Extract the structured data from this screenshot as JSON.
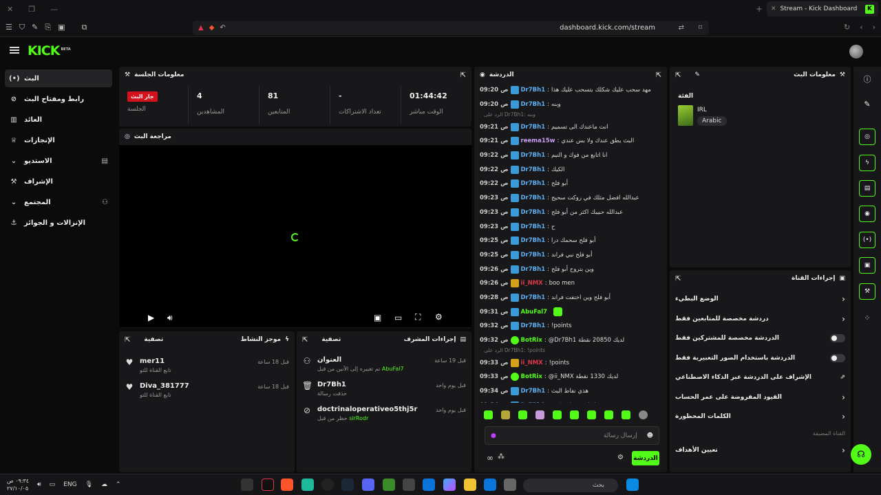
{
  "browser": {
    "tab_title": "Stream - Kick Dashboard",
    "url": "dashboard.kick.com/stream"
  },
  "sidebar": {
    "items": [
      {
        "label": "البث",
        "icon": "broadcast-icon"
      },
      {
        "label": "رابط ومفتاح البث",
        "icon": "link-icon"
      },
      {
        "label": "العائد",
        "icon": "revenue-icon"
      },
      {
        "label": "الإنجازات",
        "icon": "trophy-icon"
      },
      {
        "label": "الاستديو",
        "icon": "studio-icon"
      },
      {
        "label": "الإشراف",
        "icon": "wrench-icon"
      },
      {
        "label": "المجتمع",
        "icon": "community-icon"
      },
      {
        "label": "الإنزالات و الجوائز",
        "icon": "drops-icon"
      }
    ]
  },
  "session": {
    "title": "معلومات الجلسة",
    "live_badge": "جار البث",
    "session_label": "الجلسة",
    "viewers": "4",
    "viewers_label": "المشاهدين",
    "followers": "81",
    "followers_label": "المتابعين",
    "subs": "-",
    "subs_label": "تعداد الاشتراكات",
    "uptime": "01:44:42",
    "uptime_label": "الوقت مباشر"
  },
  "preview": {
    "title": "مراجعة البث"
  },
  "activity": {
    "title": "موجز النشاط",
    "filter": "تصفية",
    "items": [
      {
        "name": "mer11",
        "desc": "تابع القناة للتو",
        "when": "قبل 18 ساعة"
      },
      {
        "name": "Diva_381777",
        "desc": "تابع القناة للتو",
        "when": "قبل 18 ساعة"
      }
    ]
  },
  "mod_actions": {
    "title": "إجراءات المشرف",
    "filter": "تصفية",
    "items": [
      {
        "name": "العنوان",
        "desc_pre": "تم تغييره إلى الآنين من قبل ",
        "desc_user": "AbuFal7",
        "when": "قبل 19 ساعة"
      },
      {
        "name": "Dr7Bh1",
        "desc_pre": "حذفت رسالة",
        "desc_user": "",
        "when": "قبل يوم واحد"
      },
      {
        "name": "doctrinaloperativeo5thj5r",
        "desc_pre": "حظر من قبل ",
        "desc_user": "sirRodr",
        "when": "قبل يوم واحد"
      }
    ]
  },
  "chat": {
    "title": "الدردشة",
    "messages": [
      {
        "time": "09:20",
        "suffix": "ص",
        "user": "Dr7Bh1",
        "color": "#5ab0f0",
        "text": "مهد سحب عليك شكلك بتسحب عليك هذا"
      },
      {
        "time": "09:20",
        "suffix": "ص",
        "user": "Dr7Bh1",
        "color": "#5ab0f0",
        "text": "وبنه"
      },
      {
        "time": "09:21",
        "suffix": "ص",
        "user": "Dr7Bh1",
        "color": "#5ab0f0",
        "text": "انت ماعندك الى تسميم",
        "reply": "الرد على Dr7Bh1: وبنه"
      },
      {
        "time": "09:21",
        "suffix": "ص",
        "user": "reema15w",
        "color": "#c89df5",
        "text": "البث يطق عندك ولا بس عندي"
      },
      {
        "time": "09:22",
        "suffix": "ص",
        "user": "Dr7Bh1",
        "color": "#5ab0f0",
        "text": "انا اتابع من فوك و النيم"
      },
      {
        "time": "09:22",
        "suffix": "ص",
        "user": "Dr7Bh1",
        "color": "#5ab0f0",
        "text": "الكيك"
      },
      {
        "time": "09:22",
        "suffix": "ص",
        "user": "Dr7Bh1",
        "color": "#5ab0f0",
        "text": "أبو فلح"
      },
      {
        "time": "09:23",
        "suffix": "ص",
        "user": "Dr7Bh1",
        "color": "#5ab0f0",
        "text": "عبدالله افضل مثلك في روكت سحيج"
      },
      {
        "time": "09:23",
        "suffix": "ص",
        "user": "Dr7Bh1",
        "color": "#5ab0f0",
        "text": "عبدالله حبيبك اكثر من أبو فلح"
      },
      {
        "time": "09:23",
        "suffix": "ص",
        "user": "Dr7Bh1",
        "color": "#5ab0f0",
        "text": "ح"
      },
      {
        "time": "09:25",
        "suffix": "ص",
        "user": "Dr7Bh1",
        "color": "#5ab0f0",
        "text": "أبو فلح سحمك درا"
      },
      {
        "time": "09:25",
        "suffix": "ص",
        "user": "Dr7Bh1",
        "color": "#5ab0f0",
        "text": "أبو فلح نبي فراند"
      },
      {
        "time": "09:26",
        "suffix": "ص",
        "user": "Dr7Bh1",
        "color": "#5ab0f0",
        "text": "وين بتروح أبو فلح"
      },
      {
        "time": "09:26",
        "suffix": "ص",
        "user": "ii_NMX",
        "color": "#e0364b",
        "text": "boo men"
      },
      {
        "time": "09:28",
        "suffix": "ص",
        "user": "Dr7Bh1",
        "color": "#5ab0f0",
        "text": "أبو فلح وين اختفت فراند"
      },
      {
        "time": "09:31",
        "suffix": "ص",
        "user": "AbuFal7",
        "color": "#53fc18",
        "text": ""
      },
      {
        "time": "09:32",
        "suffix": "ص",
        "user": "Dr7Bh1",
        "color": "#5ab0f0",
        "text": "!points"
      },
      {
        "time": "09:32",
        "suffix": "ص",
        "user": "BotRix",
        "color": "#53fc18",
        "text": "@Dr7Bh1 لديك 20850 نقطة"
      },
      {
        "time": "09:33",
        "suffix": "ص",
        "user": "ii_NMX",
        "color": "#e0364b",
        "text": "!points",
        "reply": "الرد على Dr7Bh1: !points"
      },
      {
        "time": "09:33",
        "suffix": "ص",
        "user": "BotRix",
        "color": "#53fc18",
        "text": "@ii_NMX لديك 1330 نقطة"
      },
      {
        "time": "09:34",
        "suffix": "ص",
        "user": "Dr7Bh1",
        "color": "#5ab0f0",
        "text": "هذي نفاط البث"
      },
      {
        "time": "09:34",
        "suffix": "ص",
        "user": "Dr7Bh1",
        "color": "#5ab0f0",
        "text": "اذ انت متواجد كثير"
      }
    ],
    "input_placeholder": "إرسال رسالة",
    "send_label": "الدردشة"
  },
  "stream_info": {
    "title": "معلومات البث",
    "category_label": "الفئة",
    "category_name": "IRL",
    "language": "Arabic"
  },
  "channel_actions": {
    "title": "إجراءات القناة",
    "items": [
      {
        "label": "الوضع البطيء",
        "kind": "arrow"
      },
      {
        "label": "دردشة مخصصة للمتابعين فقط",
        "kind": "arrow"
      },
      {
        "label": "الدردشة مخصصة للمشتركين فقط",
        "kind": "toggle"
      },
      {
        "label": "الدردشة باستخدام الصور التعبيرية فقط",
        "kind": "toggle"
      },
      {
        "label": "الإشراف على الدردشة عبر الذكاء الاصطناعي",
        "kind": "ext"
      },
      {
        "label": "القيود المفروضة على عمر الحساب",
        "kind": "arrow"
      },
      {
        "label": "الكلمات المحظورة",
        "kind": "arrow"
      },
      {
        "label": "القناة المضيفة",
        "kind": "section"
      },
      {
        "label": "تعيين الأهداف",
        "kind": "arrow"
      }
    ]
  },
  "taskbar": {
    "search_placeholder": "بحث",
    "lang": "ENG",
    "time": "٠٩:٣٤ ص",
    "date": "٢٧/١٠/٠٥"
  },
  "colors": {
    "accent": "#53fc18",
    "panel": "#18181b",
    "live": "#d4121e"
  }
}
